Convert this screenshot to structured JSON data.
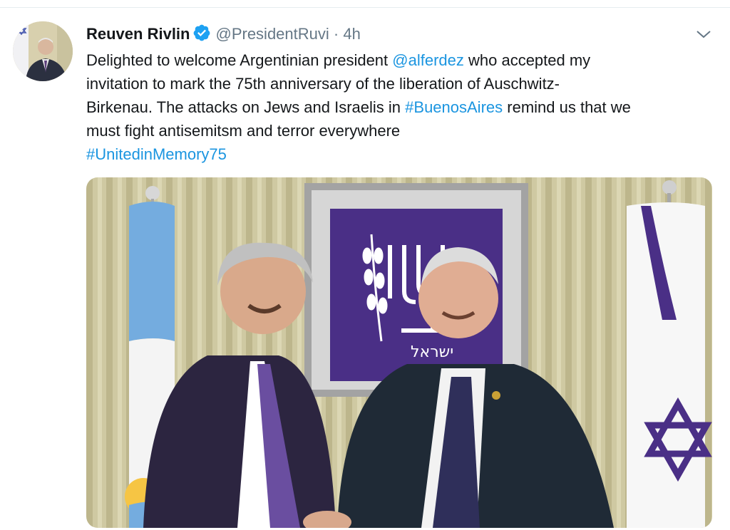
{
  "tweet": {
    "author_name": "Reuven Rivlin",
    "handle": "@PresidentRuvi",
    "separator": "·",
    "time": "4h",
    "text": {
      "l1_a": "Delighted to welcome Argentinian president ",
      "l1_mention": "@alferdez",
      "l1_b": " who accepted my",
      "l2": "invitation to mark the 75th anniversary of the liberation of Auschwitz-",
      "l3_a": "Birkenau. The attacks on Jews and Israelis in ",
      "l3_hashtag": "#BuenosAires",
      "l3_b": " remind us that we",
      "l4": "must fight antisemitsm and terror everywhere",
      "l5_hashtag": "#UnitedinMemory75"
    },
    "emblem_text": "ישראל"
  },
  "colors": {
    "link": "#1b95e0",
    "verified": "#1da1f2",
    "text": "#14171a",
    "muted": "#657786"
  },
  "icons": {
    "verified": "verified-badge-icon",
    "menu": "chevron-down-icon"
  }
}
